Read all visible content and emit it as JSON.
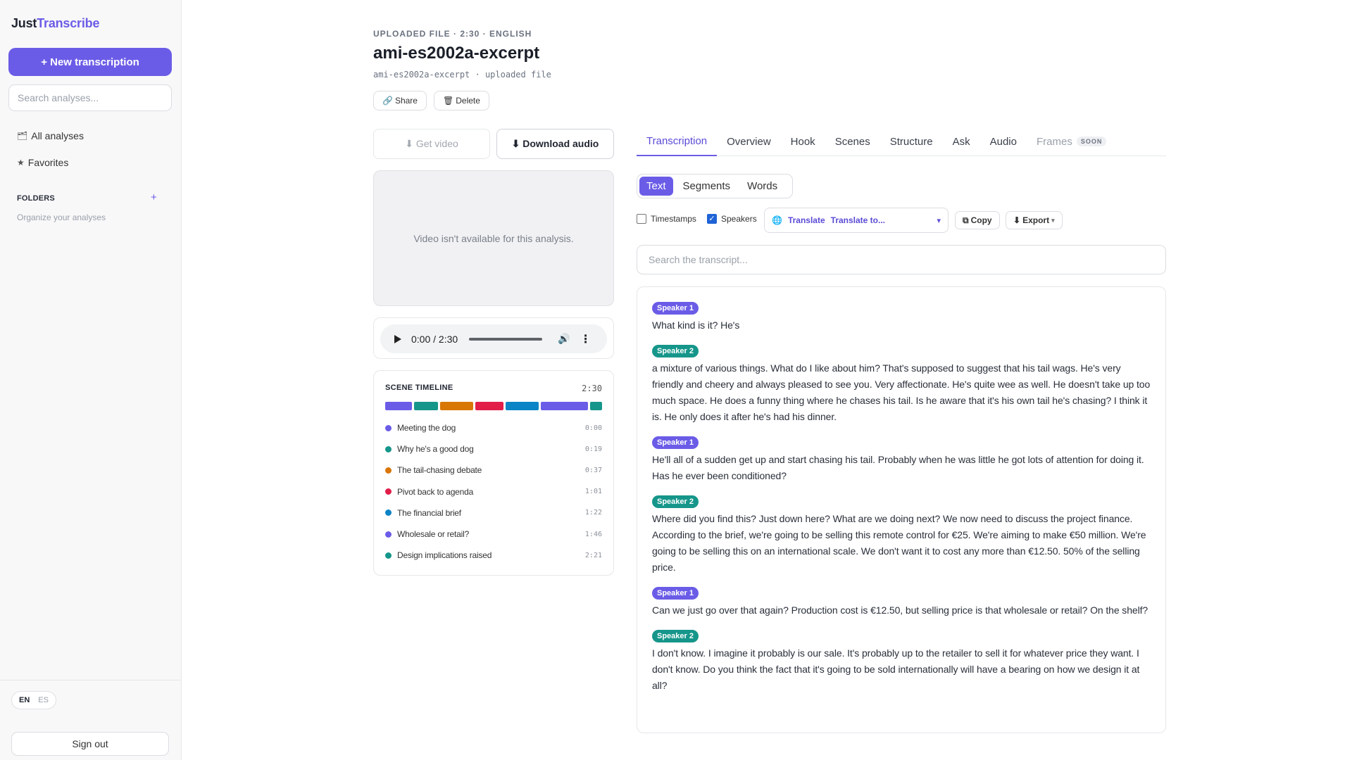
{
  "sidebar": {
    "brand_part1": "Just",
    "brand_part2": "Transcribe",
    "new_button": "+ New transcription",
    "search_placeholder": "Search analyses...",
    "nav": [
      {
        "icon": "folder-icon",
        "glyph": "🗂",
        "label": "All analyses"
      },
      {
        "icon": "star-icon",
        "glyph": "★",
        "label": "Favorites"
      }
    ],
    "folders_title": "FOLDERS",
    "folders_add": "+",
    "folders_hint": "Organize your analyses",
    "lang": {
      "en": "EN",
      "es": "ES",
      "active": "EN"
    },
    "sign_out": "Sign out"
  },
  "header": {
    "meta": "UPLOADED FILE · 2:30 · ENGLISH",
    "title": "ami-es2002a-excerpt",
    "subtitle": "ami-es2002a-excerpt · uploaded file",
    "share_label": "Share",
    "delete_label": "Delete"
  },
  "media": {
    "get_video_label": "⬇ Get video",
    "download_audio_label": "⬇ Download audio",
    "video_unavailable": "Video isn't available for this analysis.",
    "audio_time": "0:00 / 2:30"
  },
  "timeline": {
    "title": "SCENE TIMELINE",
    "total": "2:30",
    "scenes": [
      {
        "label": "Meeting the dog",
        "time": "0:00",
        "color": "#6b5ce7",
        "share": 0.13
      },
      {
        "label": "Why he's a good dog",
        "time": "0:19",
        "color": "#16968a",
        "share": 0.12
      },
      {
        "label": "The tail-chasing debate",
        "time": "0:37",
        "color": "#d97706",
        "share": 0.16
      },
      {
        "label": "Pivot back to agenda",
        "time": "1:01",
        "color": "#e11d48",
        "share": 0.14
      },
      {
        "label": "The financial brief",
        "time": "1:22",
        "color": "#0b84c6",
        "share": 0.16
      },
      {
        "label": "Wholesale or retail?",
        "time": "1:46",
        "color": "#6b5ce7",
        "share": 0.23
      },
      {
        "label": "Design implications raised",
        "time": "2:21",
        "color": "#16968a",
        "share": 0.06
      }
    ]
  },
  "tabs": [
    {
      "label": "Transcription",
      "active": true
    },
    {
      "label": "Overview"
    },
    {
      "label": "Hook"
    },
    {
      "label": "Scenes"
    },
    {
      "label": "Structure"
    },
    {
      "label": "Ask"
    },
    {
      "label": "Audio"
    },
    {
      "label": "Frames",
      "badge": "SOON",
      "disabled": true
    }
  ],
  "view_modes": [
    {
      "label": "Text",
      "active": true
    },
    {
      "label": "Segments"
    },
    {
      "label": "Words"
    }
  ],
  "options": {
    "timestamps_label": "Timestamps",
    "timestamps_checked": false,
    "speakers_label": "Speakers",
    "speakers_checked": true,
    "translate_label": "Translate",
    "translate_value": "Translate to...",
    "copy_label": "Copy",
    "export_label": "Export"
  },
  "transcript": {
    "search_placeholder": "Search the transcript...",
    "utterances": [
      {
        "speaker": "Speaker 1",
        "cls": "s1",
        "text": "What kind is it? He's"
      },
      {
        "speaker": "Speaker 2",
        "cls": "s2",
        "text": "a mixture of various things. What do I like about him? That's supposed to suggest that his tail wags. He's very friendly and cheery and always pleased to see you. Very affectionate. He's quite wee as well. He doesn't take up too much space. He does a funny thing where he chases his tail. Is he aware that it's his own tail he's chasing? I think it is. He only does it after he's had his dinner."
      },
      {
        "speaker": "Speaker 1",
        "cls": "s1",
        "text": "He'll all of a sudden get up and start chasing his tail. Probably when he was little he got lots of attention for doing it. Has he ever been conditioned?"
      },
      {
        "speaker": "Speaker 2",
        "cls": "s2",
        "text": "Where did you find this? Just down here? What are we doing next? We now need to discuss the project finance. According to the brief, we're going to be selling this remote control for €25. We're aiming to make €50 million. We're going to be selling this on an international scale. We don't want it to cost any more than €12.50. 50% of the selling price."
      },
      {
        "speaker": "Speaker 1",
        "cls": "s1",
        "text": "Can we just go over that again? Production cost is €12.50, but selling price is that wholesale or retail? On the shelf?"
      },
      {
        "speaker": "Speaker 2",
        "cls": "s2",
        "text": "I don't know. I imagine it probably is our sale. It's probably up to the retailer to sell it for whatever price they want. I don't know. Do you think the fact that it's going to be sold internationally will have a bearing on how we design it at all?"
      }
    ]
  }
}
